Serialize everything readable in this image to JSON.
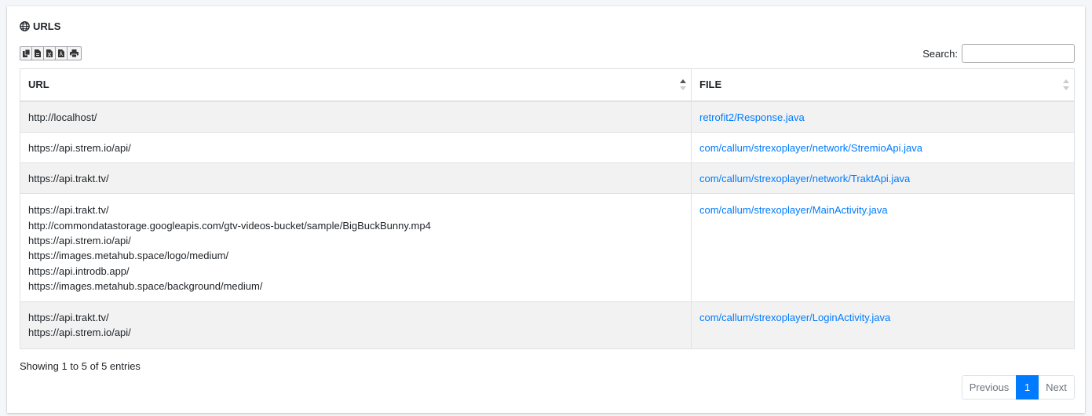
{
  "card": {
    "title": "URLS",
    "title_icon": "globe-icon"
  },
  "toolbar": {
    "buttons": [
      {
        "name": "copy",
        "icon": "copy-icon"
      },
      {
        "name": "csv",
        "icon": "file-csv-icon"
      },
      {
        "name": "excel",
        "icon": "file-excel-icon"
      },
      {
        "name": "pdf",
        "icon": "file-pdf-icon"
      },
      {
        "name": "print",
        "icon": "print-icon"
      }
    ]
  },
  "search": {
    "label": "Search:",
    "value": ""
  },
  "table": {
    "columns": [
      {
        "label": "URL",
        "sort": "asc"
      },
      {
        "label": "FILE",
        "sort": "none"
      }
    ],
    "rows": [
      {
        "urls": [
          "http://localhost/"
        ],
        "file": "retrofit2/Response.java"
      },
      {
        "urls": [
          "https://api.strem.io/api/"
        ],
        "file": "com/callum/strexoplayer/network/StremioApi.java"
      },
      {
        "urls": [
          "https://api.trakt.tv/"
        ],
        "file": "com/callum/strexoplayer/network/TraktApi.java"
      },
      {
        "urls": [
          "https://api.trakt.tv/",
          "http://commondatastorage.googleapis.com/gtv-videos-bucket/sample/BigBuckBunny.mp4",
          "https://api.strem.io/api/",
          "https://images.metahub.space/logo/medium/",
          "https://api.introdb.app/",
          "https://images.metahub.space/background/medium/"
        ],
        "file": "com/callum/strexoplayer/MainActivity.java"
      },
      {
        "urls": [
          "https://api.trakt.tv/",
          "https://api.strem.io/api/"
        ],
        "file": "com/callum/strexoplayer/LoginActivity.java"
      }
    ]
  },
  "info": "Showing 1 to 5 of 5 entries",
  "pagination": {
    "previous": "Previous",
    "current": "1",
    "next": "Next"
  },
  "colors": {
    "link": "#007bff",
    "active_page": "#007bff",
    "striped_row": "#f2f2f2"
  }
}
